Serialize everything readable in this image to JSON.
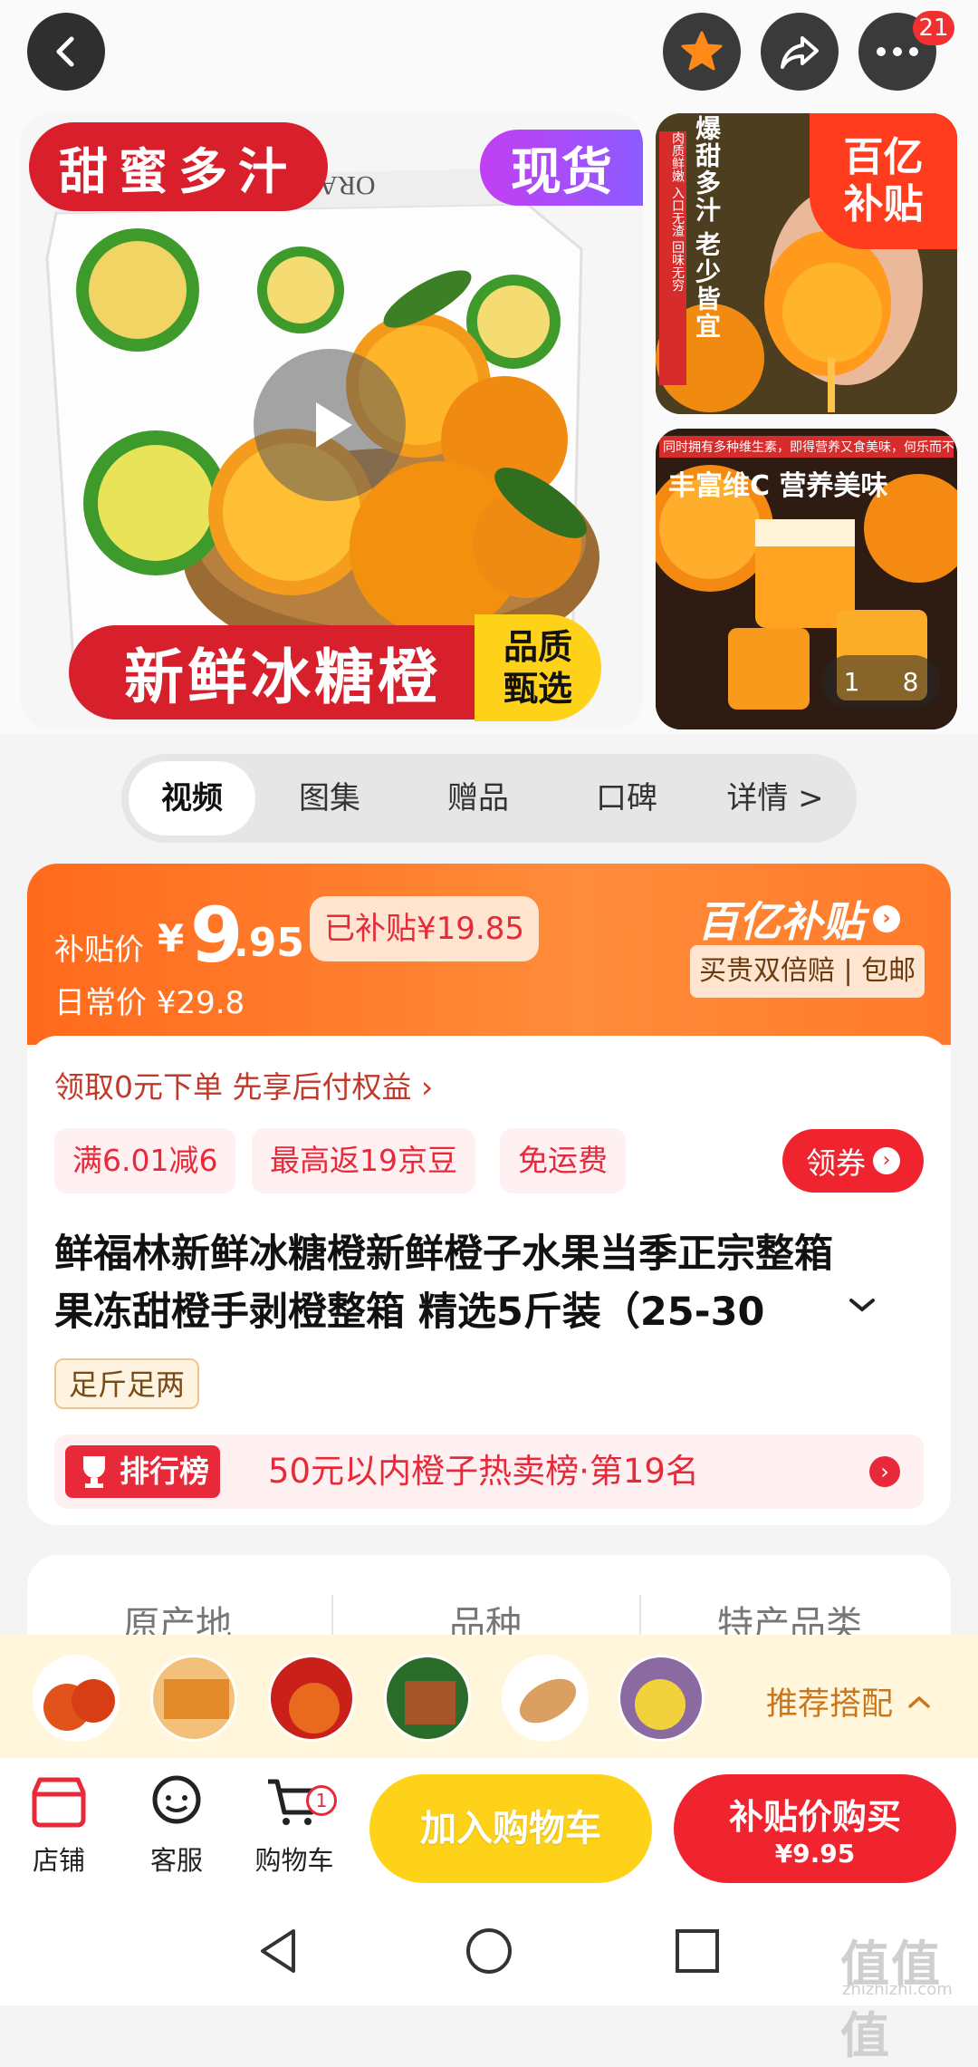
{
  "topbar": {
    "back_icon": "chevron-left-icon",
    "favorite_icon": "star-icon",
    "share_icon": "share-icon",
    "more_icon": "more-dots-icon",
    "more_badge": "21"
  },
  "gallery": {
    "main": {
      "tag_left": "甜蜜多汁",
      "tag_right": "现货",
      "box_text": "ORANGE",
      "banner": "新鲜冰糖橙",
      "banner_tag_line1": "品质",
      "banner_tag_line2": "甄选"
    },
    "side_top": {
      "vertical_1": "爆甜多汁",
      "vertical_2": "老少皆宜",
      "small_side": "肉质鲜嫩 入口无渣 回味无穷",
      "badge_line1": "百亿",
      "badge_line2": "补贴"
    },
    "side_bottom": {
      "small_top": "同时拥有多种维生素，即得营养又食美味，何乐而不为",
      "caption": "丰富维C 营养美味",
      "page_current": "1",
      "page_total": "8"
    }
  },
  "tabs": [
    "视频",
    "图集",
    "赠品",
    "口碑",
    "详情 >"
  ],
  "price": {
    "label": "补贴价",
    "currency": "¥",
    "integer": "9",
    "decimal": ".95",
    "subsidized": "已补贴¥19.85",
    "daily_label": "日常价 ¥29.8",
    "brand_line": "百亿补贴",
    "guarantee": "买贵双倍赔 | 包邮"
  },
  "promo": {
    "link": "领取0元下单 先享后付权益 ›",
    "coupons": [
      "满6.01减6",
      "最高返19京豆",
      "免运费"
    ],
    "claim_button": "领券"
  },
  "product": {
    "title_line1": "鲜福林新鲜冰糖橙新鲜橙子水果当季正宗整箱",
    "title_line2": "果冻甜橙手剥橙整箱 精选5斤装（25-30",
    "tag": "足斤足两"
  },
  "ranking": {
    "badge": "排行榜",
    "text": "50元以内橙子热卖榜·第19名"
  },
  "attributes": [
    "原产地",
    "品种",
    "特产品类"
  ],
  "recommend": {
    "label": "推荐搭配"
  },
  "bottom_nav": {
    "shop": "店铺",
    "service": "客服",
    "cart": "购物车",
    "cart_badge": "1",
    "add_cart": "加入购物车",
    "buy_line1": "补贴价购买",
    "buy_line2": "¥9.95"
  },
  "watermark": {
    "brand": "值值值",
    "url": "zhizhizhi.com"
  },
  "colors": {
    "accent_red": "#e8293a",
    "accent_orange": "#ff6a1c",
    "yellow_button": "#ffd21a"
  }
}
